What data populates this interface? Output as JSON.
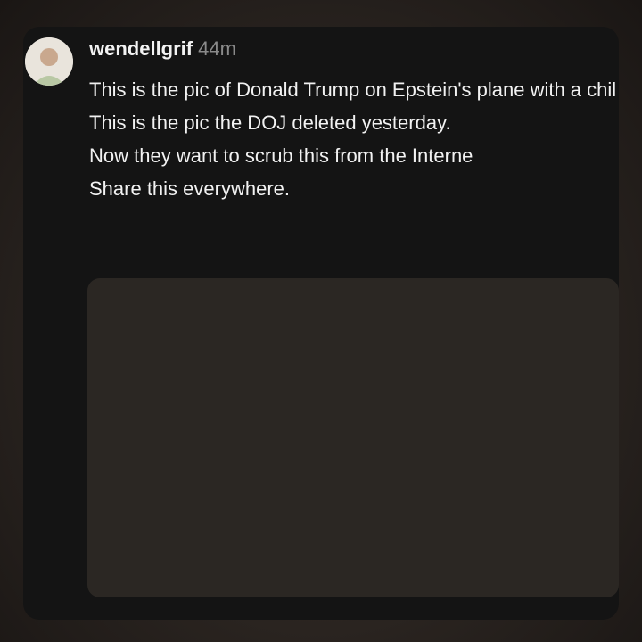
{
  "post": {
    "username": "wendellgrif",
    "timestamp": "44m",
    "avatar_icon": "avatar-icon",
    "caption_lines": [
      "This is the pic of Donald Trump on Epstein's plane with a child.",
      "This is the pic the DOJ deleted yesterday.",
      "Now they want to scrub this from the Interne",
      "Share this everywhere."
    ]
  },
  "colors": {
    "card_background": "#141414",
    "text_primary": "#f2f2f2",
    "text_secondary": "#8a8a8a"
  }
}
